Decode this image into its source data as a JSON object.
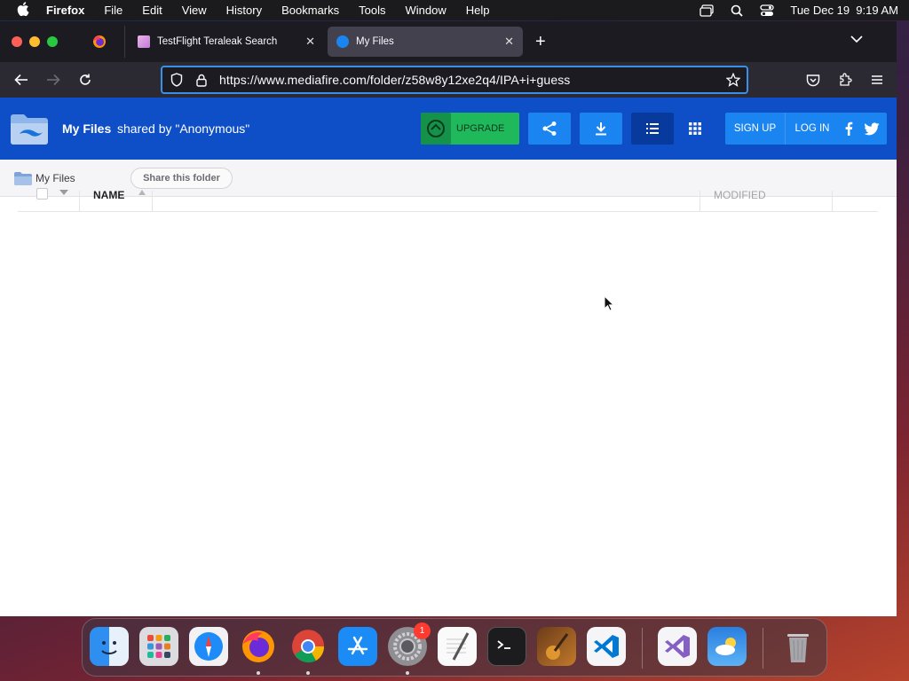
{
  "menubar": {
    "app_name": "Firefox",
    "items": [
      "File",
      "Edit",
      "View",
      "History",
      "Bookmarks",
      "Tools",
      "Window",
      "Help"
    ],
    "datetime": "Tue Dec 19  9:19 AM"
  },
  "tabs": [
    {
      "title": "TestFlight Teraleak Search",
      "active": false
    },
    {
      "title": "My Files",
      "active": true
    }
  ],
  "urlbar": {
    "url": "https://www.mediafire.com/folder/z58w8y12xe2q4/IPA+i+guess"
  },
  "mediafire": {
    "title": "My Files",
    "shared_by": "shared by \"Anonymous\"",
    "upgrade_label": "UPGRADE",
    "signup_label": "SIGN UP",
    "login_label": "LOG IN",
    "brand_color": "#0e4fc7",
    "accent_color": "#1a85f0",
    "upgrade_color": "#1fb85a"
  },
  "breadcrumb": {
    "label": "My Files",
    "share_button": "Share this folder"
  },
  "file_list": {
    "columns": {
      "name": "NAME",
      "modified": "MODIFIED"
    },
    "rows": []
  },
  "dock": {
    "apps": [
      "Finder",
      "Launchpad",
      "Safari",
      "Firefox",
      "Chrome",
      "App Store",
      "System Settings",
      "TextEdit",
      "Terminal",
      "GarageBand",
      "Visual Studio Code",
      "Visual Studio",
      "Weather",
      "Trash"
    ],
    "settings_badge": "1"
  }
}
